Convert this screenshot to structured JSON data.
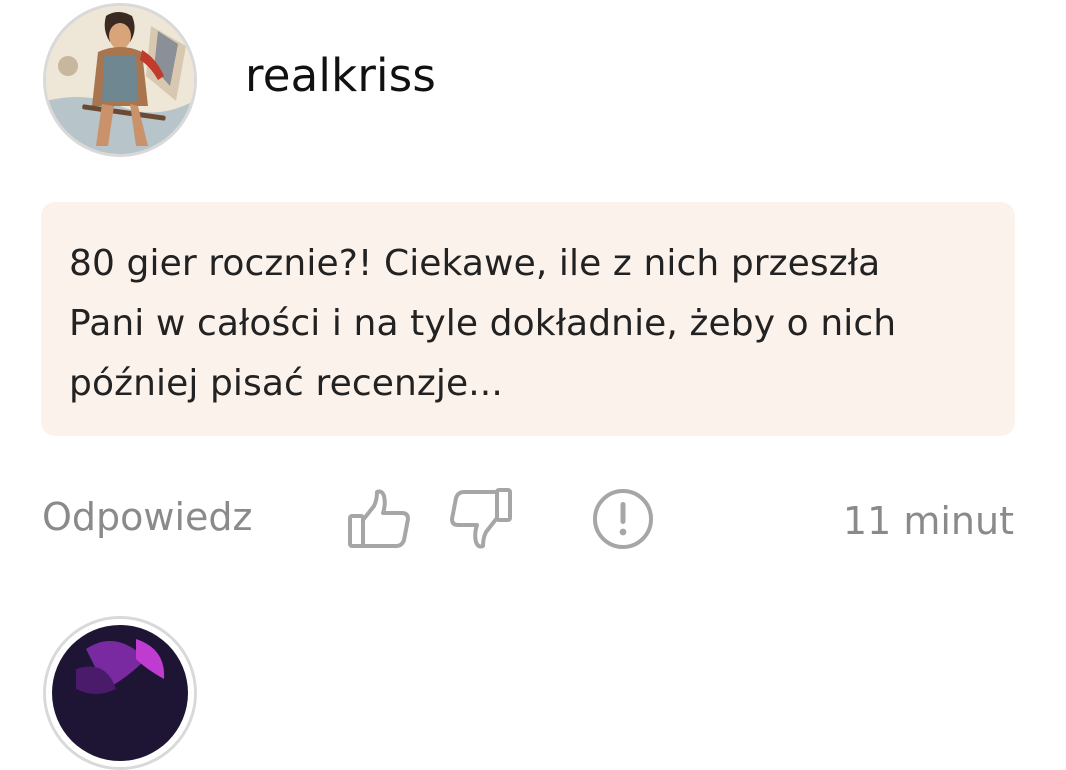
{
  "comment": {
    "username": "realkriss",
    "text": "80 gier rocznie?! Ciekawe, ile z nich przeszła\nPani w całości i na tyle dokładnie, żeby o nich\npóźniej pisać recenzje...",
    "reply_label": "Odpowiedz",
    "time": "11 minut",
    "icons": {
      "like": "thumbs-up-icon",
      "dislike": "thumbs-down-icon",
      "report": "exclamation-circle-icon"
    }
  },
  "colors": {
    "bubble_background": "#fcf2ec",
    "muted_text": "#8a8a8a",
    "icon_stroke": "#a6a6a6",
    "avatar_border": "#d9d9d9"
  }
}
